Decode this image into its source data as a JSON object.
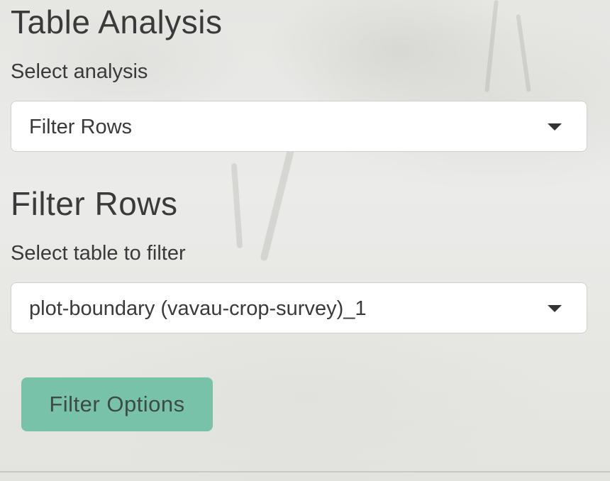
{
  "analysis": {
    "title": "Table Analysis",
    "select_label": "Select analysis",
    "selected_analysis": "Filter Rows"
  },
  "filter": {
    "heading": "Filter Rows",
    "table_label": "Select table to filter",
    "selected_table": "plot-boundary (vavau-crop-survey)_1",
    "options_button": "Filter Options"
  },
  "icons": {
    "dropdown": "chevron-down-icon"
  },
  "colors": {
    "button_bg": "#78c2aa",
    "button_text": "#3d4a45",
    "text": "#3a3a3a"
  }
}
